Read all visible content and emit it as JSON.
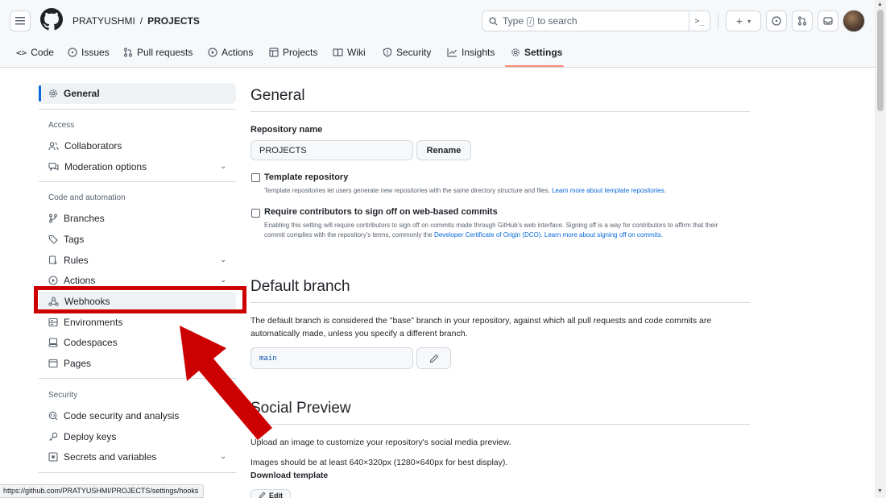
{
  "header": {
    "owner": "PRATYUSHMI",
    "separator": "/",
    "repo": "PROJECTS",
    "search": {
      "prefix": "Type",
      "key": "/",
      "suffix": "to search",
      "terminal_glyph": ">_"
    },
    "plus_glyph": "+",
    "caret_glyph": "▾"
  },
  "repo_nav": [
    {
      "label": "Code",
      "icon": "code-icon"
    },
    {
      "label": "Issues",
      "icon": "issue-icon"
    },
    {
      "label": "Pull requests",
      "icon": "pull-request-icon"
    },
    {
      "label": "Actions",
      "icon": "play-icon"
    },
    {
      "label": "Projects",
      "icon": "table-icon"
    },
    {
      "label": "Wiki",
      "icon": "book-icon"
    },
    {
      "label": "Security",
      "icon": "shield-icon"
    },
    {
      "label": "Insights",
      "icon": "graph-icon"
    },
    {
      "label": "Settings",
      "icon": "gear-icon",
      "active": true
    }
  ],
  "sidebar": {
    "general": "General",
    "sections": [
      {
        "heading": "Access",
        "items": [
          "Collaborators",
          "Moderation options"
        ]
      },
      {
        "heading": "Code and automation",
        "items": [
          "Branches",
          "Tags",
          "Rules",
          "Actions",
          "Webhooks",
          "Environments",
          "Codespaces",
          "Pages"
        ]
      },
      {
        "heading": "Security",
        "items": [
          "Code security and analysis",
          "Deploy keys",
          "Secrets and variables"
        ]
      }
    ]
  },
  "main": {
    "general_title": "General",
    "repo_name_label": "Repository name",
    "repo_name_value": "PROJECTS",
    "rename_button": "Rename",
    "template_label": "Template repository",
    "template_note": "Template repositories let users generate new repositories with the same directory structure and files.",
    "template_link": "Learn more about template repositories.",
    "signoff_label": "Require contributors to sign off on web-based commits",
    "signoff_note": "Enabling this setting will require contributors to sign off on commits made through GitHub's web interface. Signing off is a way for contributors to affirm that their commit complies with the repository's terms, commonly the",
    "signoff_link1": "Developer Certificate of Origin (DCO).",
    "signoff_link2": "Learn more about signing off on commits.",
    "default_branch_title": "Default branch",
    "default_branch_desc": "The default branch is considered the \"base\" branch in your repository, against which all pull requests and code commits are automatically made, unless you specify a different branch.",
    "default_branch_value": "main",
    "social_title": "Social Preview",
    "social_desc": "Upload an image to customize your repository's social media preview.",
    "social_size": "Images should be at least 640×320px (1280×640px for best display).",
    "download_template": "Download template",
    "edit_button": "Edit"
  },
  "status_bar": "https://github.com/PRATYUSHMI/PROJECTS/settings/hooks",
  "colors": {
    "accent": "#0969da",
    "active_tab_underline": "#fd8c73",
    "highlight": "#cc0000"
  }
}
